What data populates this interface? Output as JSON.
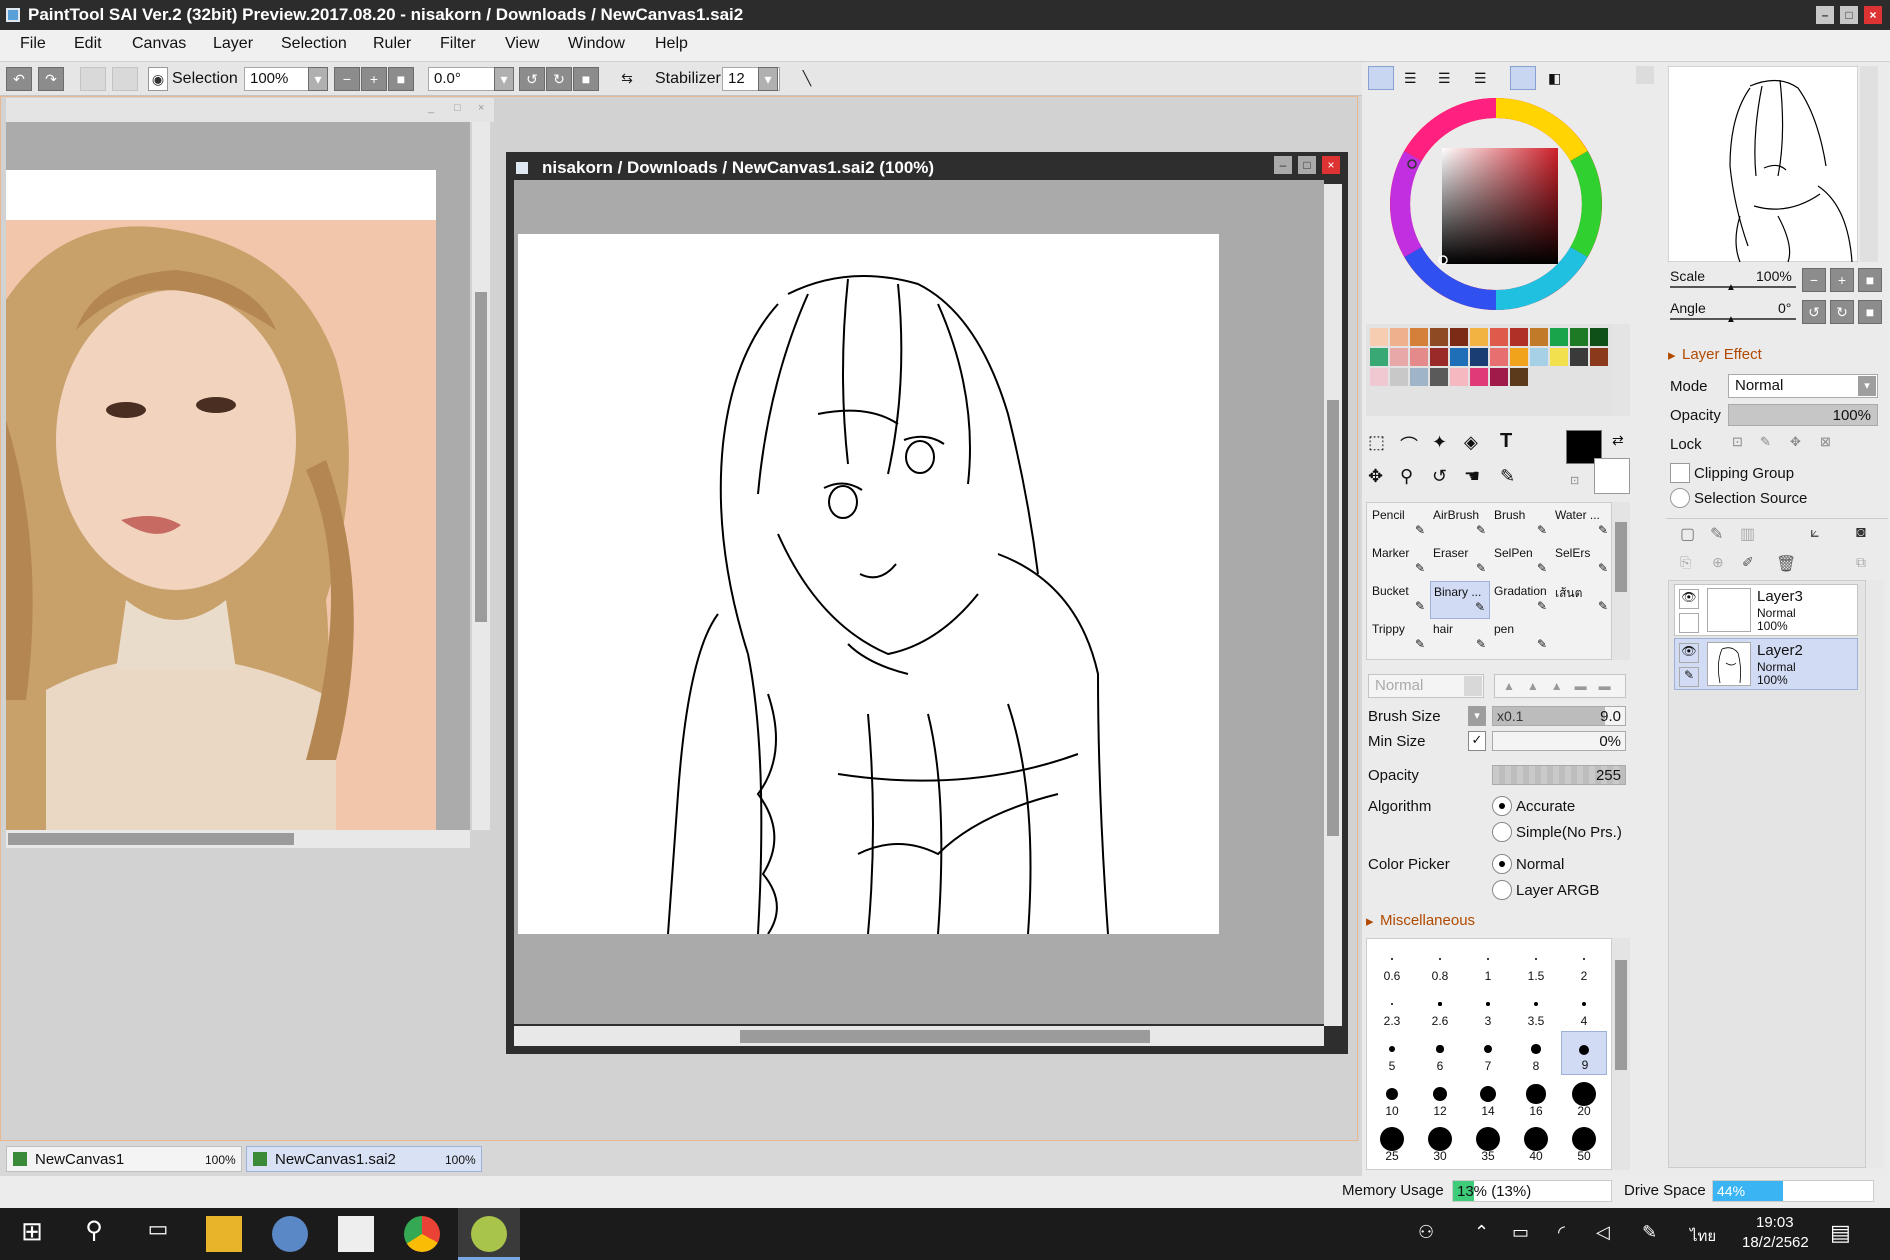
{
  "window": {
    "title": "PaintTool SAI Ver.2 (32bit) Preview.2017.08.20 - nisakorn / Downloads / NewCanvas1.sai2"
  },
  "menu": [
    "File",
    "Edit",
    "Canvas",
    "Layer",
    "Selection",
    "Ruler",
    "Filter",
    "View",
    "Window",
    "Help"
  ],
  "toolbar": {
    "selection_label": "Selection",
    "zoom_value": "100%",
    "angle_value": "0.0°",
    "stabilizer_label": "Stabilizer",
    "stabilizer_value": "12"
  },
  "canvas_window": {
    "title": "nisakorn / Downloads / NewCanvas1.sai2 (100%)"
  },
  "tabs": [
    {
      "name": "NewCanvas1",
      "zoom": "100%"
    },
    {
      "name": "NewCanvas1.sai2",
      "zoom": "100%"
    }
  ],
  "status": {
    "memory_label": "Memory Usage",
    "memory_value": "13% (13%)",
    "memory_fraction": 0.13,
    "drive_label": "Drive Space",
    "drive_value": "44%",
    "drive_fraction": 0.44
  },
  "navigator": {
    "scale_label": "Scale",
    "scale_value": "100%",
    "angle_label": "Angle",
    "angle_value": "0°"
  },
  "layer_effect": {
    "header": "Layer Effect",
    "mode_label": "Mode",
    "mode_value": "Normal",
    "opacity_label": "Opacity",
    "opacity_value": "100%",
    "lock_label": "Lock",
    "clipping_label": "Clipping Group",
    "selection_source_label": "Selection Source"
  },
  "layers": [
    {
      "name": "Layer3",
      "mode": "Normal",
      "opacity": "100%",
      "selected": false
    },
    {
      "name": "Layer2",
      "mode": "Normal",
      "opacity": "100%",
      "selected": true
    }
  ],
  "brush_tools": [
    {
      "name": "Pencil"
    },
    {
      "name": "AirBrush"
    },
    {
      "name": "Brush"
    },
    {
      "name": "Water ..."
    },
    {
      "name": "Marker"
    },
    {
      "name": "Eraser"
    },
    {
      "name": "SelPen"
    },
    {
      "name": "SelErs"
    },
    {
      "name": "Bucket"
    },
    {
      "name": "Binary ..."
    },
    {
      "name": "Gradation"
    },
    {
      "name": "เส้นต"
    },
    {
      "name": "Trippy"
    },
    {
      "name": "hair"
    },
    {
      "name": "pen"
    },
    {
      "name": ""
    }
  ],
  "brush_settings": {
    "blend_mode": "Normal",
    "size_label": "Brush Size",
    "size_multiplier": "x0.1",
    "size_value": "9.0",
    "min_size_label": "Min Size",
    "min_size_value": "0%",
    "opacity_label": "Opacity",
    "opacity_value": "255",
    "algorithm_label": "Algorithm",
    "algorithm_opt1": "Accurate",
    "algorithm_opt2": "Simple(No Prs.)",
    "color_picker_label": "Color Picker",
    "picker_opt1": "Normal",
    "picker_opt2": "Layer ARGB",
    "misc_label": "Miscellaneous"
  },
  "brush_sizes": [
    "0.6",
    "0.8",
    "1",
    "1.5",
    "2",
    "2.3",
    "2.6",
    "3",
    "3.5",
    "4",
    "5",
    "6",
    "7",
    "8",
    "9",
    "10",
    "12",
    "14",
    "16",
    "20",
    "25",
    "30",
    "35",
    "40",
    "50"
  ],
  "swatch_colors": [
    "#f6cdb0",
    "#eeb08d",
    "#d4803a",
    "#8e4a22",
    "#7b2b16",
    "#f3b342",
    "#de5a4a",
    "#b03028",
    "#c07a28",
    "#19a34a",
    "#1f7a26",
    "#0f4f18",
    "#3aa875",
    "#e9a8a8",
    "#e58a8a",
    "#9a2a2a",
    "#1e6fb8",
    "#1a3e74",
    "#e86f6f",
    "#f2a31c",
    "#a6d0e6",
    "#f2e04e",
    "#3a3a3a",
    "#8a3a1a",
    "#f0c8d2",
    "#c8c8c8",
    "#a0b4c8",
    "#5a5a5a",
    "#f5b8c0",
    "#e03a78",
    "#a01a4a",
    "#5a3a1a"
  ],
  "taskbar": {
    "time": "19:03",
    "date": "18/2/2562",
    "lang": "ไทย"
  }
}
